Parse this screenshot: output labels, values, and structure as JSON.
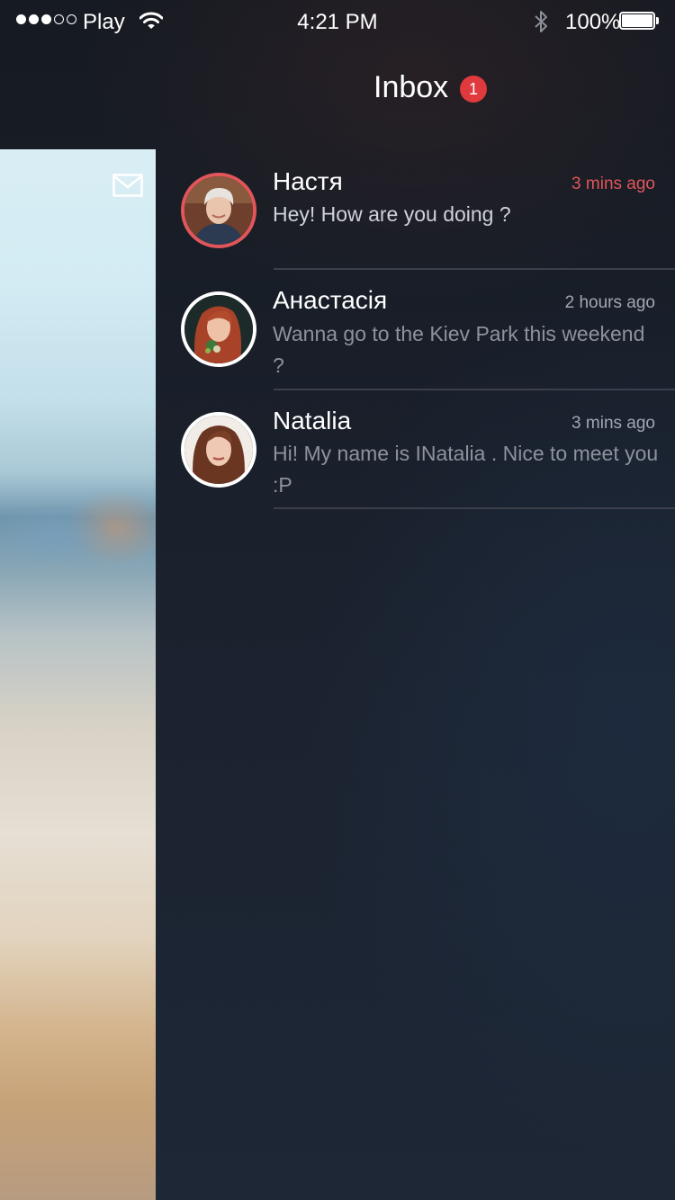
{
  "status_bar": {
    "signal_bars_filled": 3,
    "signal_bars_total": 5,
    "carrier": "Play",
    "time": "4:21 PM",
    "battery_percent": "100%",
    "battery_level": 1.0
  },
  "header": {
    "title": "Inbox",
    "badge_count": "1"
  },
  "side_panel": {
    "icon": "mail-icon"
  },
  "messages": [
    {
      "name": "Настя",
      "time": "3 mins ago",
      "preview": "Hey! How are you doing ?",
      "unread": true,
      "accent_color": "#e0565a"
    },
    {
      "name": "Анастасія",
      "time": "2 hours ago",
      "preview": "Wanna go to the Kiev Park this weekend ?",
      "unread": false
    },
    {
      "name": "Natalia",
      "time": "3 mins ago",
      "preview": "Hi! My name is  INatalia . Nice to meet you :P",
      "unread": false
    }
  ]
}
